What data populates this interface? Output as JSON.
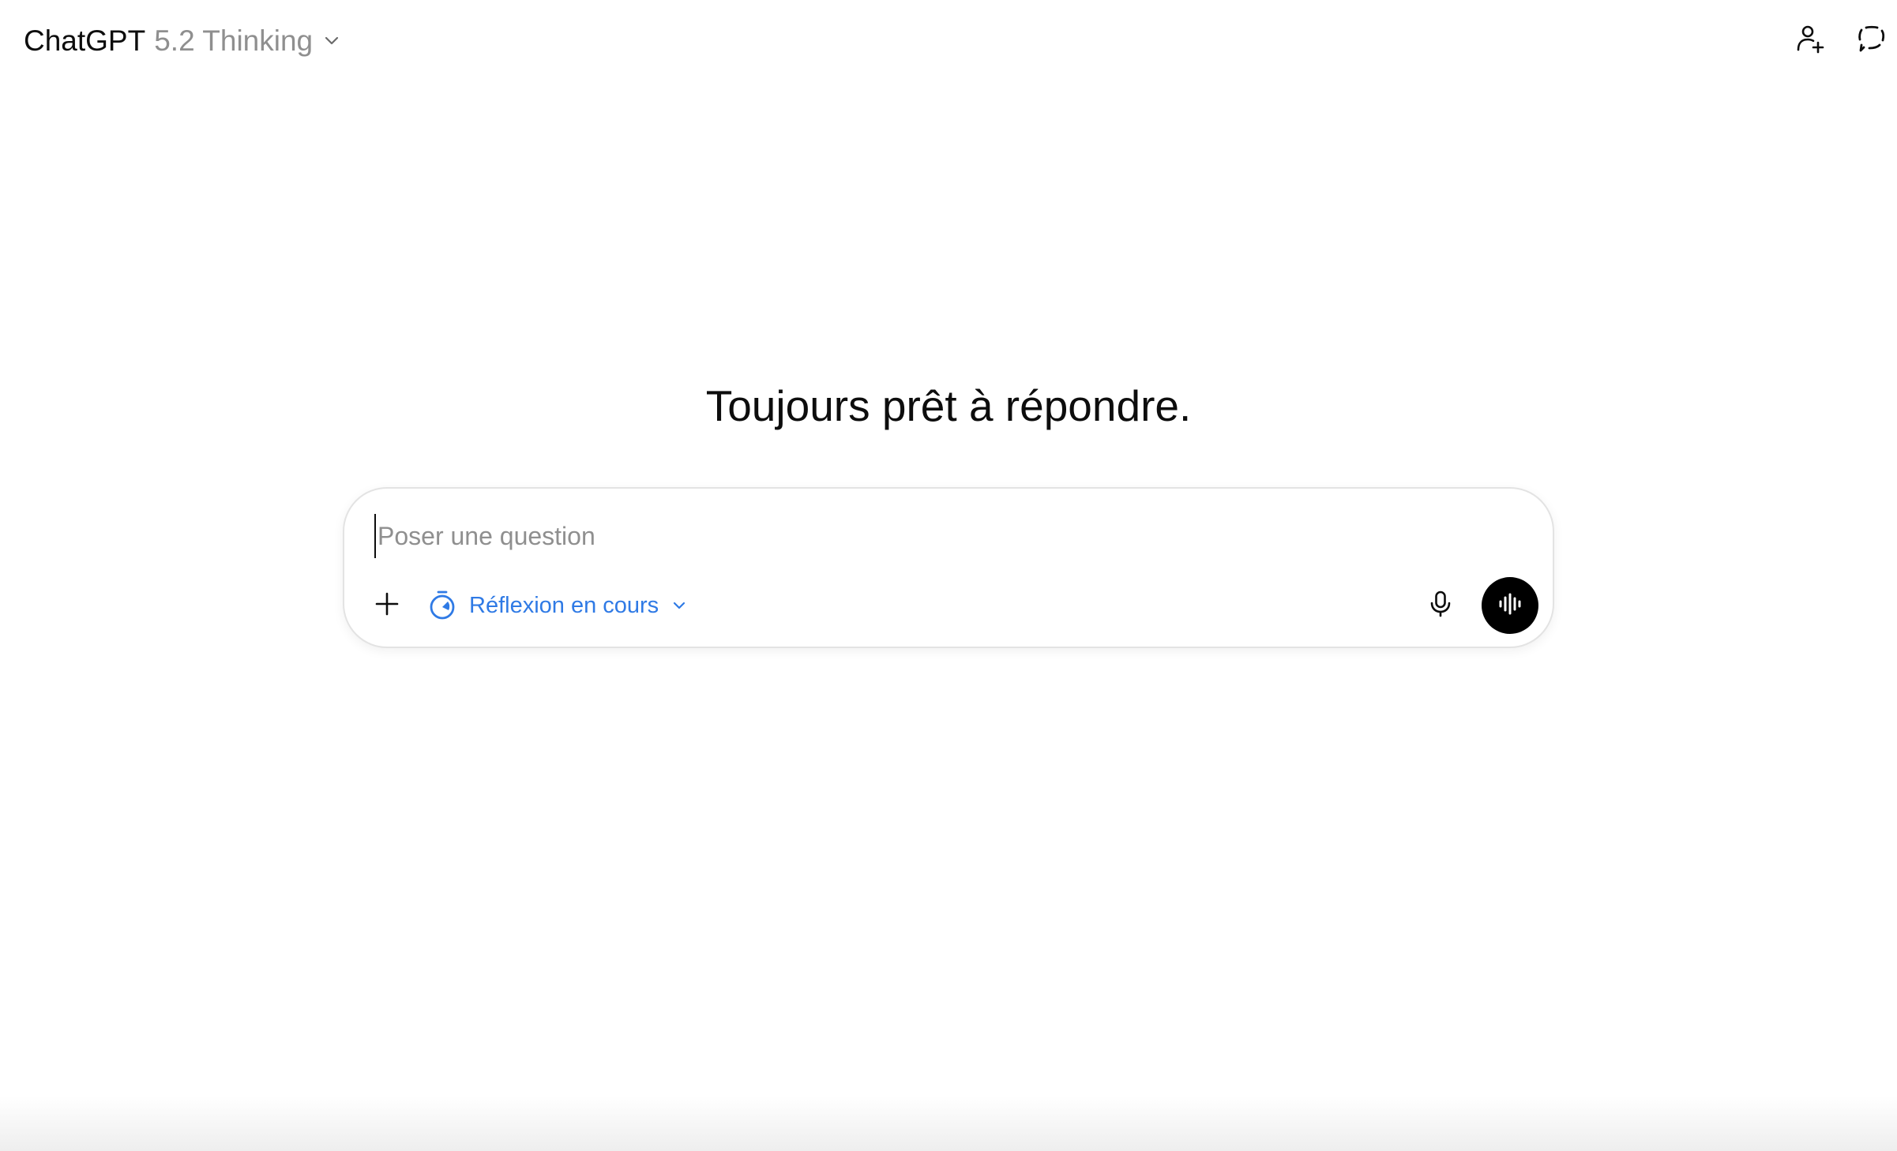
{
  "header": {
    "model_name": "ChatGPT",
    "model_version": "5.2 Thinking",
    "icons": {
      "model_dropdown": "chevron-down-icon",
      "invite": "user-plus-icon",
      "temporary_chat": "dashed-chat-bubble-icon"
    }
  },
  "main": {
    "headline": "Toujours prêt à répondre."
  },
  "composer": {
    "placeholder": "Poser une question",
    "value": "",
    "mode_label": "Réflexion en cours",
    "icons": {
      "attach": "plus-icon",
      "mode": "stopwatch-icon",
      "mode_dropdown": "chevron-down-icon",
      "dictate": "microphone-icon",
      "voice": "waveform-icon"
    }
  },
  "colors": {
    "accent_blue": "#2f7ae5",
    "text_primary": "#0d0d0d",
    "text_muted": "#8f8f8f",
    "border": "#e3e3e3",
    "voice_button_bg": "#000000"
  }
}
